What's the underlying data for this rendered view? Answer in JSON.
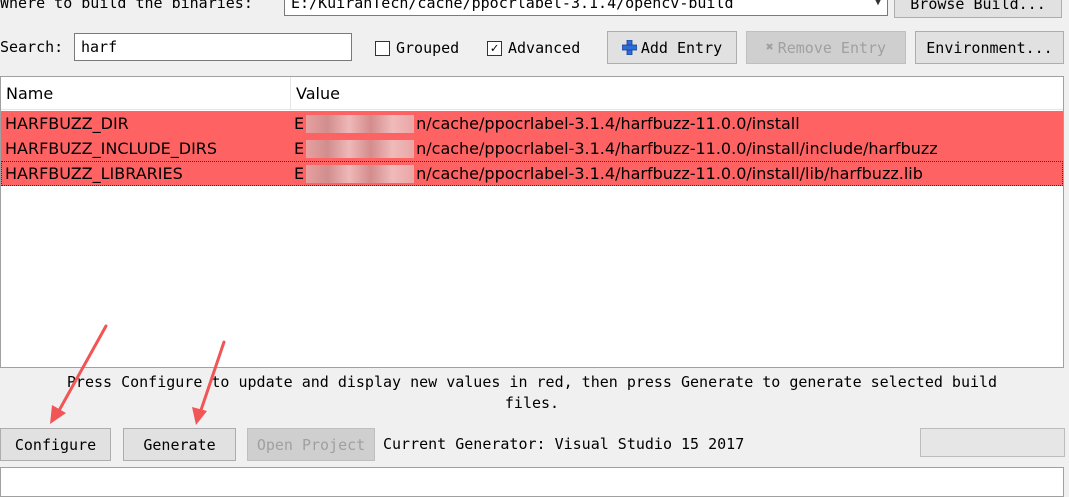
{
  "build": {
    "label": "Where to build the binaries:",
    "path": "E:/KuiranTech/cache/ppocrlabel-3.1.4/opencv-build",
    "browse_label": "Browse Build..."
  },
  "search": {
    "label": "Search:",
    "value": "harf"
  },
  "options": {
    "grouped_label": "Grouped",
    "advanced_label": "Advanced",
    "grouped_checked": false,
    "advanced_checked": true
  },
  "toolbar": {
    "add_entry_label": "Add Entry",
    "remove_entry_label": "Remove Entry",
    "environment_label": "Environment..."
  },
  "table": {
    "headers": {
      "name": "Name",
      "value": "Value"
    },
    "rows": [
      {
        "name": "HARFBUZZ_DIR",
        "value_prefix": "E",
        "value_suffix": "n/cache/ppocrlabel-3.1.4/harfbuzz-11.0.0/install"
      },
      {
        "name": "HARFBUZZ_INCLUDE_DIRS",
        "value_prefix": "E",
        "value_suffix": "n/cache/ppocrlabel-3.1.4/harfbuzz-11.0.0/install/include/harfbuzz"
      },
      {
        "name": "HARFBUZZ_LIBRARIES",
        "value_prefix": "E",
        "value_suffix": "n/cache/ppocrlabel-3.1.4/harfbuzz-11.0.0/install/lib/harfbuzz.lib"
      }
    ],
    "row_color": "#ff6262"
  },
  "status": {
    "line1": "Press Configure to update and display new values in red, then press Generate to generate selected build",
    "line2": "files."
  },
  "actions": {
    "configure_label": "Configure",
    "generate_label": "Generate",
    "open_project_label": "Open Project",
    "current_generator": "Current Generator: Visual Studio 15 2017"
  },
  "annotations": {
    "arrow_color": "#f15555"
  }
}
